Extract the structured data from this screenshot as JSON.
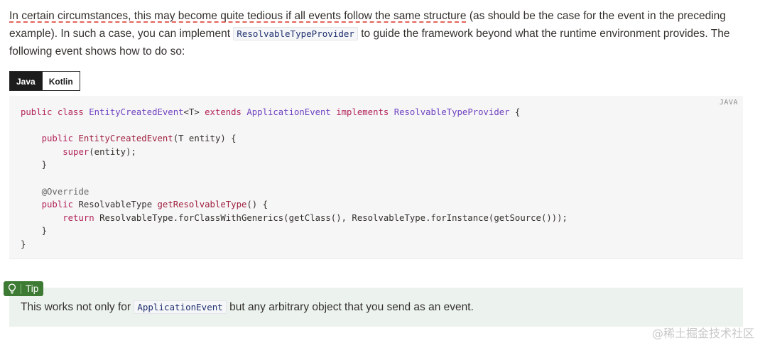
{
  "intro": {
    "part1": "In certain circumstances, this may become quite tedious if all events follow the same structure",
    "part2": " (as should be the case for the event in the preceding example). In such a case, you can implement ",
    "code": "ResolvableTypeProvider",
    "part3": " to guide the framework beyond what the runtime environment provides. The following event shows how to do so:"
  },
  "tabs": {
    "java": "Java",
    "kotlin": "Kotlin"
  },
  "code_block": {
    "language_label": "JAVA",
    "line1": {
      "kw1": "public class ",
      "type1": "EntityCreatedEvent",
      "plain1": "<T> ",
      "kw2": "extends ",
      "type2": "ApplicationEvent",
      "plain2": " ",
      "kw3": "implements ",
      "type3": "ResolvableTypeProvider",
      "plain3": " {"
    },
    "line3": {
      "indent": "    ",
      "kw": "public ",
      "fn": "EntityCreatedEvent",
      "rest": "(T entity) {"
    },
    "line4": {
      "indent": "        ",
      "kw": "super",
      "rest": "(entity);"
    },
    "line5": "    }",
    "line7": {
      "indent": "    ",
      "annotation": "@Override"
    },
    "line8": {
      "indent": "    ",
      "kw": "public ",
      "plain": "ResolvableType ",
      "fn": "getResolvableType",
      "rest": "() {"
    },
    "line9": {
      "indent": "        ",
      "kw": "return ",
      "rest": "ResolvableType.forClassWithGenerics(getClass(), ResolvableType.forInstance(getSource()));"
    },
    "line10": "    }",
    "line11": "}"
  },
  "tip": {
    "label": "Tip",
    "icon": "lightbulb-icon",
    "text_before": "This works not only for ",
    "code": "ApplicationEvent",
    "text_after": " but any arbitrary object that you send as an event."
  },
  "watermark": "@稀土掘金技术社区"
}
